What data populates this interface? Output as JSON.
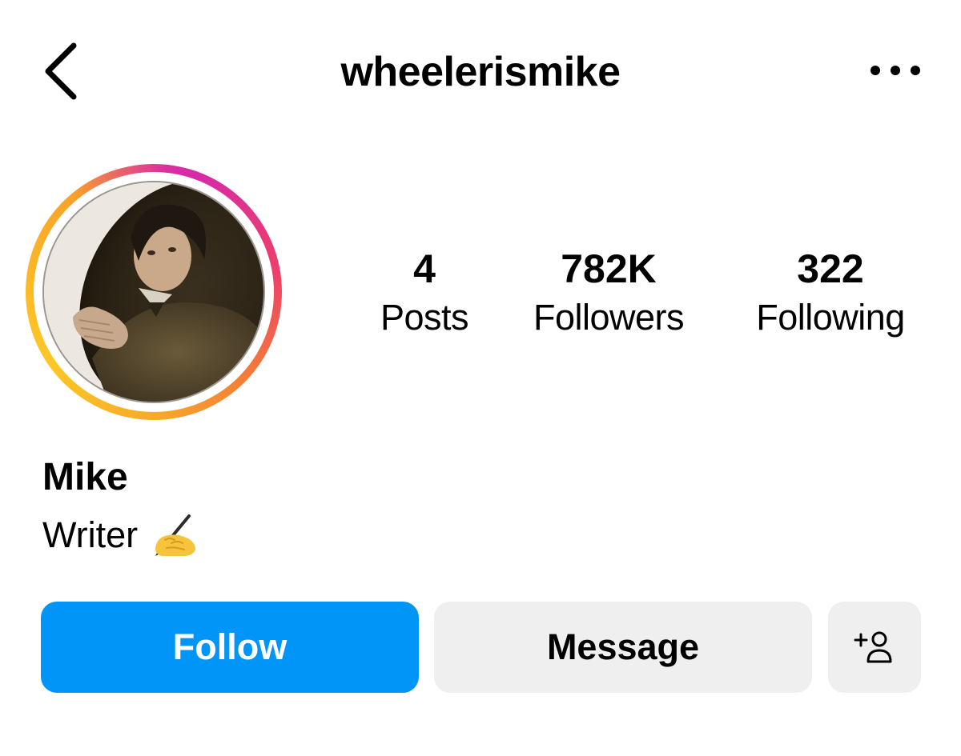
{
  "header": {
    "username": "wheelerismike",
    "back_icon": "chevron-left-icon",
    "more_icon": "more-horizontal-icon"
  },
  "profile": {
    "avatar_alt": "profile photo",
    "story_ring_colors": [
      "#d62aa8",
      "#ee3f6a",
      "#f47a38",
      "#fcc826"
    ],
    "display_name": "Mike",
    "bio": "Writer",
    "bio_emoji_icon": "writing-hand-icon"
  },
  "stats": [
    {
      "value": "4",
      "label": "Posts"
    },
    {
      "value": "782K",
      "label": "Followers"
    },
    {
      "value": "322",
      "label": "Following"
    }
  ],
  "actions": {
    "follow_label": "Follow",
    "message_label": "Message",
    "add_user_icon": "add-user-icon"
  },
  "colors": {
    "follow_button": "#0095f6",
    "secondary_button": "#efefef"
  }
}
